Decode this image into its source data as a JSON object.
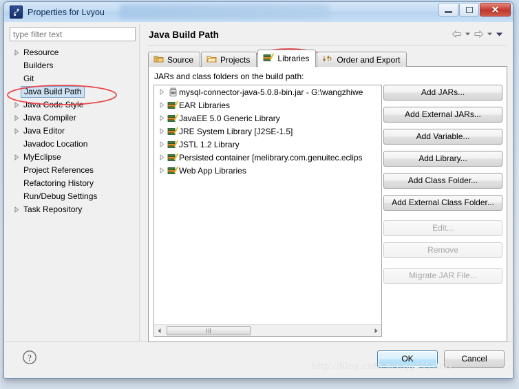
{
  "window": {
    "title": "Properties for Lvyou",
    "title_redacted": "",
    "icon": "eclipse-properties-icon",
    "caption": {
      "minimize": "minimize-button",
      "restore": "restore-button",
      "close": "close-button"
    }
  },
  "filter": {
    "placeholder": "type filter text",
    "value": ""
  },
  "sidebar": {
    "items": [
      {
        "label": "Resource",
        "expandable": true,
        "selected": false
      },
      {
        "label": "Builders",
        "expandable": false,
        "selected": false
      },
      {
        "label": "Git",
        "expandable": false,
        "selected": false
      },
      {
        "label": "Java Build Path",
        "expandable": false,
        "selected": true
      },
      {
        "label": "Java Code Style",
        "expandable": true,
        "selected": false
      },
      {
        "label": "Java Compiler",
        "expandable": true,
        "selected": false
      },
      {
        "label": "Java Editor",
        "expandable": true,
        "selected": false
      },
      {
        "label": "Javadoc Location",
        "expandable": false,
        "selected": false
      },
      {
        "label": "MyEclipse",
        "expandable": true,
        "selected": false
      },
      {
        "label": "Project References",
        "expandable": false,
        "selected": false
      },
      {
        "label": "Refactoring History",
        "expandable": false,
        "selected": false
      },
      {
        "label": "Run/Debug Settings",
        "expandable": false,
        "selected": false
      },
      {
        "label": "Task Repository",
        "expandable": true,
        "selected": false
      }
    ]
  },
  "page": {
    "title": "Java Build Path",
    "nav": {
      "back": "back-arrow-icon",
      "back_menu": "back-dropdown-icon",
      "forward": "forward-arrow-icon",
      "forward_menu": "forward-dropdown-icon",
      "view_menu": "view-menu-icon"
    }
  },
  "tabs": [
    {
      "label": "Source",
      "icon": "source-folder-icon",
      "active": false
    },
    {
      "label": "Projects",
      "icon": "projects-folder-icon",
      "active": false
    },
    {
      "label": "Libraries",
      "icon": "libraries-books-icon",
      "active": true
    },
    {
      "label": "Order and Export",
      "icon": "order-export-icon",
      "active": false
    }
  ],
  "libraries_tab": {
    "section_label": "JARs and class folders on the build path:",
    "entries": [
      {
        "label": "mysql-connector-java-5.0.8-bin.jar - G:\\wangzhiwe",
        "icon": "jar-icon",
        "expandable": true
      },
      {
        "label": "EAR Libraries",
        "icon": "library-icon",
        "expandable": true
      },
      {
        "label": "JavaEE 5.0 Generic Library",
        "icon": "library-icon",
        "expandable": true
      },
      {
        "label": "JRE System Library [J2SE-1.5]",
        "icon": "library-icon",
        "expandable": true
      },
      {
        "label": "JSTL 1.2 Library",
        "icon": "library-icon",
        "expandable": true
      },
      {
        "label": "Persisted container [melibrary.com.genuitec.eclips",
        "icon": "library-icon",
        "expandable": true
      },
      {
        "label": "Web App Libraries",
        "icon": "library-icon",
        "expandable": true
      }
    ],
    "buttons": [
      {
        "label": "Add JARs...",
        "enabled": true
      },
      {
        "label": "Add External JARs...",
        "enabled": true
      },
      {
        "label": "Add Variable...",
        "enabled": true
      },
      {
        "label": "Add Library...",
        "enabled": true
      },
      {
        "label": "Add Class Folder...",
        "enabled": true
      },
      {
        "label": "Add External Class Folder...",
        "enabled": true
      },
      {
        "label": "Edit...",
        "enabled": false
      },
      {
        "label": "Remove",
        "enabled": false
      },
      {
        "label": "Migrate JAR File...",
        "enabled": false
      }
    ]
  },
  "footer": {
    "help": "help-icon",
    "ok": "OK",
    "cancel": "Cancel"
  },
  "watermark": "http://blog.csdn.net/qq4551091",
  "colors": {
    "annotation": "#e8484c",
    "selection": "#cde0f4",
    "default_button": "#bee6fd",
    "close_button": "#c0362e"
  }
}
